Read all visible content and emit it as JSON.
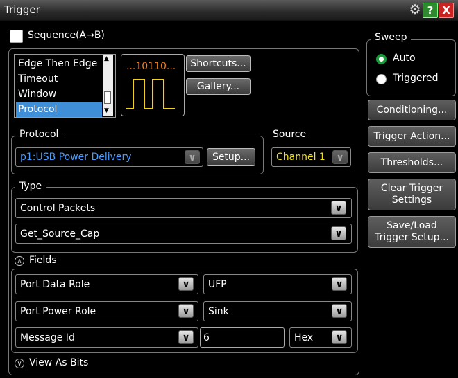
{
  "window": {
    "title": "Trigger"
  },
  "sequence": {
    "label": "Sequence(A→B)",
    "checked": false
  },
  "trigger_types": {
    "items": [
      "Edge Then Edge",
      "Timeout",
      "Window",
      "Protocol"
    ],
    "selected": "Protocol"
  },
  "preview": {
    "text": "...10110..."
  },
  "buttons": {
    "shortcuts": "Shortcuts...",
    "gallery": "Gallery...",
    "setup": "Setup..."
  },
  "protocol": {
    "label": "Protocol",
    "value": "p1:USB Power Delivery",
    "value_color": "#4a9cff"
  },
  "source": {
    "label": "Source",
    "value": "Channel 1",
    "value_color": "#f0e020"
  },
  "type": {
    "label": "Type",
    "value1": "Control Packets",
    "value2": "Get_Source_Cap"
  },
  "fields": {
    "label": "Fields",
    "rows": [
      {
        "name": "Port Data Role",
        "value": "UFP"
      },
      {
        "name": "Port Power Role",
        "value": "Sink"
      },
      {
        "name": "Message Id",
        "value": "6",
        "format": "Hex"
      }
    ],
    "view_as_bits": "View As Bits"
  },
  "sweep": {
    "label": "Sweep",
    "options": [
      "Auto",
      "Triggered"
    ],
    "selected": "Auto"
  },
  "side_buttons": {
    "conditioning": "Conditioning...",
    "trigger_action": "Trigger Action...",
    "thresholds": "Thresholds...",
    "clear_trigger": "Clear Trigger Settings",
    "save_load": "Save/Load Trigger Setup..."
  },
  "icons": {
    "settings": "gear-icon",
    "help": "help-icon",
    "close": "close-icon"
  }
}
